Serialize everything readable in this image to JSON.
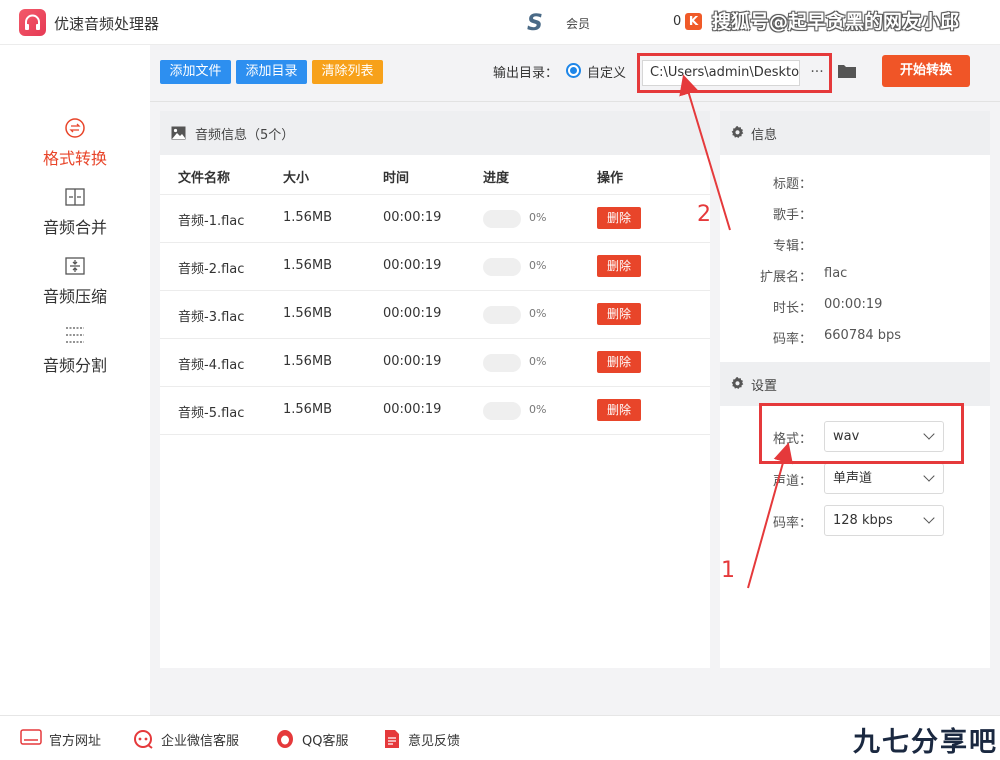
{
  "app": {
    "title": "优速音频处理器",
    "member_label": "会员",
    "count": "0",
    "badge": "K",
    "s_logo": "S"
  },
  "watermark": "搜狐号@起早贪黑的网友小邱",
  "brand_watermark": "九七分享吧",
  "sidebar": {
    "items": [
      {
        "label": "格式转换",
        "icon": "convert-icon",
        "active": true
      },
      {
        "label": "音频合并",
        "icon": "merge-icon",
        "active": false
      },
      {
        "label": "音频压缩",
        "icon": "compress-icon",
        "active": false
      },
      {
        "label": "音频分割",
        "icon": "split-icon",
        "active": false
      }
    ]
  },
  "toolbar": {
    "add_file": "添加文件",
    "add_dir": "添加目录",
    "clear_list": "清除列表",
    "output_label": "输出目录：",
    "custom_label": "自定义",
    "output_path": "C:\\Users\\admin\\Deskto",
    "more": "···",
    "start": "开始转换",
    "colors": {
      "add_file": "#2d8ff0",
      "add_dir": "#2d8ff0",
      "clear_list": "#f7a11a",
      "start": "#f05527"
    }
  },
  "list": {
    "title": "音频信息（5个）",
    "columns": [
      "文件名称",
      "大小",
      "时间",
      "进度",
      "操作"
    ],
    "rows": [
      {
        "name": "音频-1.flac",
        "size": "1.56MB",
        "time": "00:00:19",
        "progress": "0%",
        "action": "删除"
      },
      {
        "name": "音频-2.flac",
        "size": "1.56MB",
        "time": "00:00:19",
        "progress": "0%",
        "action": "删除"
      },
      {
        "name": "音频-3.flac",
        "size": "1.56MB",
        "time": "00:00:19",
        "progress": "0%",
        "action": "删除"
      },
      {
        "name": "音频-4.flac",
        "size": "1.56MB",
        "time": "00:00:19",
        "progress": "0%",
        "action": "删除"
      },
      {
        "name": "音频-5.flac",
        "size": "1.56MB",
        "time": "00:00:19",
        "progress": "0%",
        "action": "删除"
      }
    ]
  },
  "info": {
    "title": "信息",
    "fields": [
      {
        "label": "标题：",
        "value": ""
      },
      {
        "label": "歌手：",
        "value": ""
      },
      {
        "label": "专辑：",
        "value": ""
      },
      {
        "label": "扩展名：",
        "value": "flac"
      },
      {
        "label": "时长：",
        "value": "00:00:19"
      },
      {
        "label": "码率：",
        "value": "660784 bps"
      }
    ]
  },
  "settings": {
    "title": "设置",
    "format_label": "格式：",
    "format_value": "wav",
    "channel_label": "声道：",
    "channel_value": "单声道",
    "bitrate_label": "码率：",
    "bitrate_value": "128 kbps"
  },
  "annotations": {
    "one": "1",
    "two": "2",
    "color": "#e5393b"
  },
  "footer": {
    "items": [
      {
        "label": "官方网址",
        "icon": "website-icon"
      },
      {
        "label": "企业微信客服",
        "icon": "wechat-service-icon"
      },
      {
        "label": "QQ客服",
        "icon": "qq-icon"
      },
      {
        "label": "意见反馈",
        "icon": "feedback-icon"
      }
    ]
  }
}
